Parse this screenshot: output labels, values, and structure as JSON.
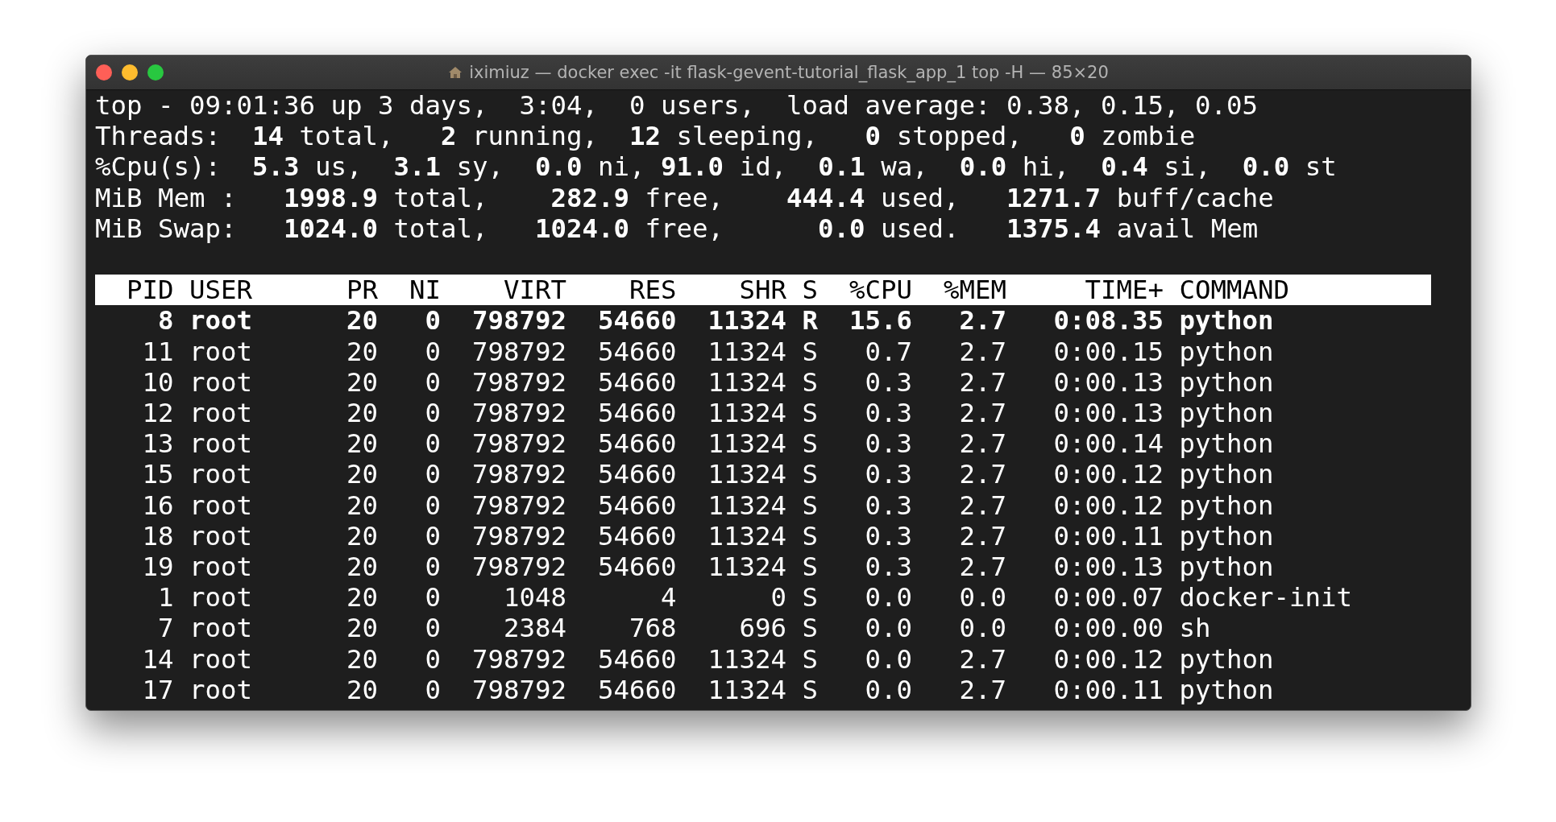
{
  "window": {
    "title": "iximiuz — docker exec -it flask-gevent-tutorial_flask_app_1 top -H — 85×20"
  },
  "summary": [
    "top - 09:01:36 up 3 days,  3:04,  0 users,  load average: 0.38, 0.15, 0.05",
    "Threads:  **14** total,   **2** running,  **12** sleeping,   **0** stopped,   **0** zombie",
    "%Cpu(s):  **5.3** us,  **3.1** sy,  **0.0** ni, **91.0** id,  **0.1** wa,  **0.0** hi,  **0.4** si,  **0.0** st",
    "MiB Mem :   **1998.9** total,    **282.9** free,    **444.4** used,   **1271.7** buff/cache",
    "MiB Swap:   **1024.0** total,   **1024.0** free,      **0.0** used.   **1375.4** avail Mem"
  ],
  "table": {
    "columns": [
      "PID",
      "USER",
      "PR",
      "NI",
      "VIRT",
      "RES",
      "SHR",
      "S",
      "%CPU",
      "%MEM",
      "TIME+",
      "COMMAND"
    ],
    "rows": [
      {
        "highlighted": true,
        "cells": [
          "8",
          "root",
          "20",
          "0",
          "798792",
          "54660",
          "11324",
          "R",
          "15.6",
          "2.7",
          "0:08.35",
          "python"
        ]
      },
      {
        "highlighted": false,
        "cells": [
          "11",
          "root",
          "20",
          "0",
          "798792",
          "54660",
          "11324",
          "S",
          "0.7",
          "2.7",
          "0:00.15",
          "python"
        ]
      },
      {
        "highlighted": false,
        "cells": [
          "10",
          "root",
          "20",
          "0",
          "798792",
          "54660",
          "11324",
          "S",
          "0.3",
          "2.7",
          "0:00.13",
          "python"
        ]
      },
      {
        "highlighted": false,
        "cells": [
          "12",
          "root",
          "20",
          "0",
          "798792",
          "54660",
          "11324",
          "S",
          "0.3",
          "2.7",
          "0:00.13",
          "python"
        ]
      },
      {
        "highlighted": false,
        "cells": [
          "13",
          "root",
          "20",
          "0",
          "798792",
          "54660",
          "11324",
          "S",
          "0.3",
          "2.7",
          "0:00.14",
          "python"
        ]
      },
      {
        "highlighted": false,
        "cells": [
          "15",
          "root",
          "20",
          "0",
          "798792",
          "54660",
          "11324",
          "S",
          "0.3",
          "2.7",
          "0:00.12",
          "python"
        ]
      },
      {
        "highlighted": false,
        "cells": [
          "16",
          "root",
          "20",
          "0",
          "798792",
          "54660",
          "11324",
          "S",
          "0.3",
          "2.7",
          "0:00.12",
          "python"
        ]
      },
      {
        "highlighted": false,
        "cells": [
          "18",
          "root",
          "20",
          "0",
          "798792",
          "54660",
          "11324",
          "S",
          "0.3",
          "2.7",
          "0:00.11",
          "python"
        ]
      },
      {
        "highlighted": false,
        "cells": [
          "19",
          "root",
          "20",
          "0",
          "798792",
          "54660",
          "11324",
          "S",
          "0.3",
          "2.7",
          "0:00.13",
          "python"
        ]
      },
      {
        "highlighted": false,
        "cells": [
          "1",
          "root",
          "20",
          "0",
          "1048",
          "4",
          "0",
          "S",
          "0.0",
          "0.0",
          "0:00.07",
          "docker-init"
        ]
      },
      {
        "highlighted": false,
        "cells": [
          "7",
          "root",
          "20",
          "0",
          "2384",
          "768",
          "696",
          "S",
          "0.0",
          "0.0",
          "0:00.00",
          "sh"
        ]
      },
      {
        "highlighted": false,
        "cells": [
          "14",
          "root",
          "20",
          "0",
          "798792",
          "54660",
          "11324",
          "S",
          "0.0",
          "2.7",
          "0:00.12",
          "python"
        ]
      },
      {
        "highlighted": false,
        "cells": [
          "17",
          "root",
          "20",
          "0",
          "798792",
          "54660",
          "11324",
          "S",
          "0.0",
          "2.7",
          "0:00.11",
          "python"
        ]
      }
    ]
  }
}
